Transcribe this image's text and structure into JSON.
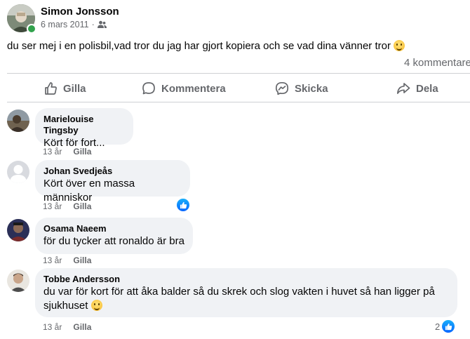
{
  "post": {
    "author": "Simon Jonsson",
    "date": "6 mars 2011",
    "separator": "·",
    "audience_icon": "friends-icon",
    "text": "du ser mej i en polisbil,vad tror du jag har gjort kopiera och se vad dina vänner tror",
    "comment_count": "4 kommentarer"
  },
  "actions": [
    {
      "label": "Gilla",
      "icon": "thumbs-up-icon"
    },
    {
      "label": "Kommentera",
      "icon": "comment-icon"
    },
    {
      "label": "Skicka",
      "icon": "messenger-icon"
    },
    {
      "label": "Dela",
      "icon": "share-icon"
    }
  ],
  "comments": [
    {
      "name": "Marielouise Tingsby",
      "text": "Kört för fort...",
      "age": "13 år",
      "like": "Gilla",
      "reactions": ""
    },
    {
      "name": "Johan Svedjeås",
      "text": "Kört över en massa människor",
      "age": "13 år",
      "like": "Gilla",
      "reactions": ""
    },
    {
      "name": "Osama Naeem",
      "text": "för du tycker att ronaldo är bra",
      "age": "13 år",
      "like": "Gilla",
      "reactions": ""
    },
    {
      "name": "Tobbe Andersson",
      "text_line1": "du var för kort för att åka balder så du skrek och slog vakten i huvet så han ligger på",
      "text_line2": "sjukhuset",
      "age": "13 år",
      "like": "Gilla",
      "reactions": "2"
    }
  ],
  "colors": {
    "accent": "#0866ff",
    "muted": "#65676b",
    "bubble": "#f0f2f5"
  }
}
